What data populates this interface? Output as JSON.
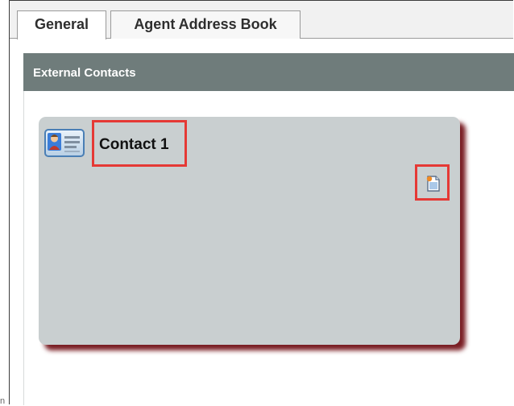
{
  "tabs": [
    {
      "label": "General",
      "active": true
    },
    {
      "label": "Agent Address Book",
      "active": false
    }
  ],
  "section": {
    "title": "External Contacts"
  },
  "contacts": [
    {
      "name": "Contact 1",
      "icon": "contact-card-icon",
      "action_icon": "notes-icon",
      "highlight_color": "#e53935"
    }
  ],
  "colors": {
    "header_bg": "#6f7c7b",
    "card_bg": "#c9cfd0",
    "card_shadow": "#7a1e24",
    "highlight": "#e53935"
  }
}
